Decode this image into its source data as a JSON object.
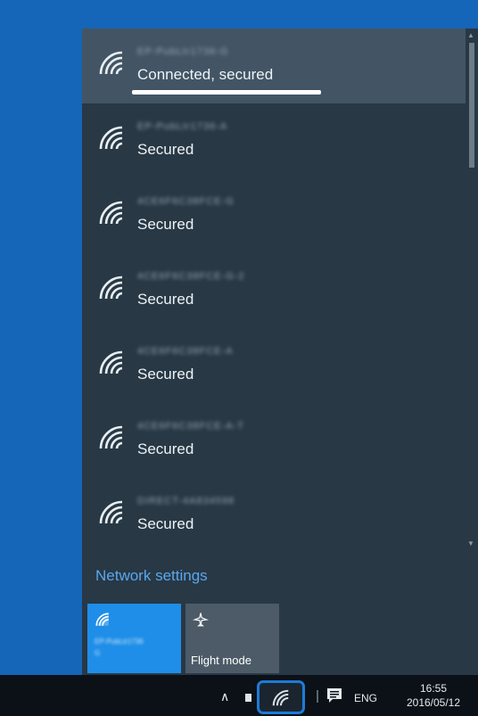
{
  "networks": [
    {
      "name": "EP-PubLtr1736-G",
      "status": "Connected, secured",
      "connected": true
    },
    {
      "name": "EP-PubLtr1736-A",
      "status": "Secured",
      "connected": false
    },
    {
      "name": "4CE6F6C38FCE-G",
      "status": "Secured",
      "connected": false
    },
    {
      "name": "4CE6F6C38FCE-G-2",
      "status": "Secured",
      "connected": false
    },
    {
      "name": "4CE6F6C38FCE-A",
      "status": "Secured",
      "connected": false
    },
    {
      "name": "4CE6F6C38FCE-A-T",
      "status": "Secured",
      "connected": false
    },
    {
      "name": "DIRECT-4A834598",
      "status": "Secured",
      "connected": false
    }
  ],
  "settings_link": "Network settings",
  "quick_actions": {
    "wifi_tile": {
      "line1": "EP-PubLtr1736",
      "line2": "G",
      "active": true
    },
    "flight_mode": {
      "label": "Flight mode",
      "active": false
    }
  },
  "taskbar": {
    "language": "ENG",
    "time": "16:55",
    "date": "2016/05/12"
  },
  "colors": {
    "desktop": "#1565b8",
    "flyout": "#283845",
    "selected_row": "#435565",
    "accent": "#1e8ee8",
    "link": "#5aa7ee"
  },
  "icons": {
    "network": "wifi-icon",
    "flight": "airplane-icon",
    "notifications": "action-center-icon"
  }
}
